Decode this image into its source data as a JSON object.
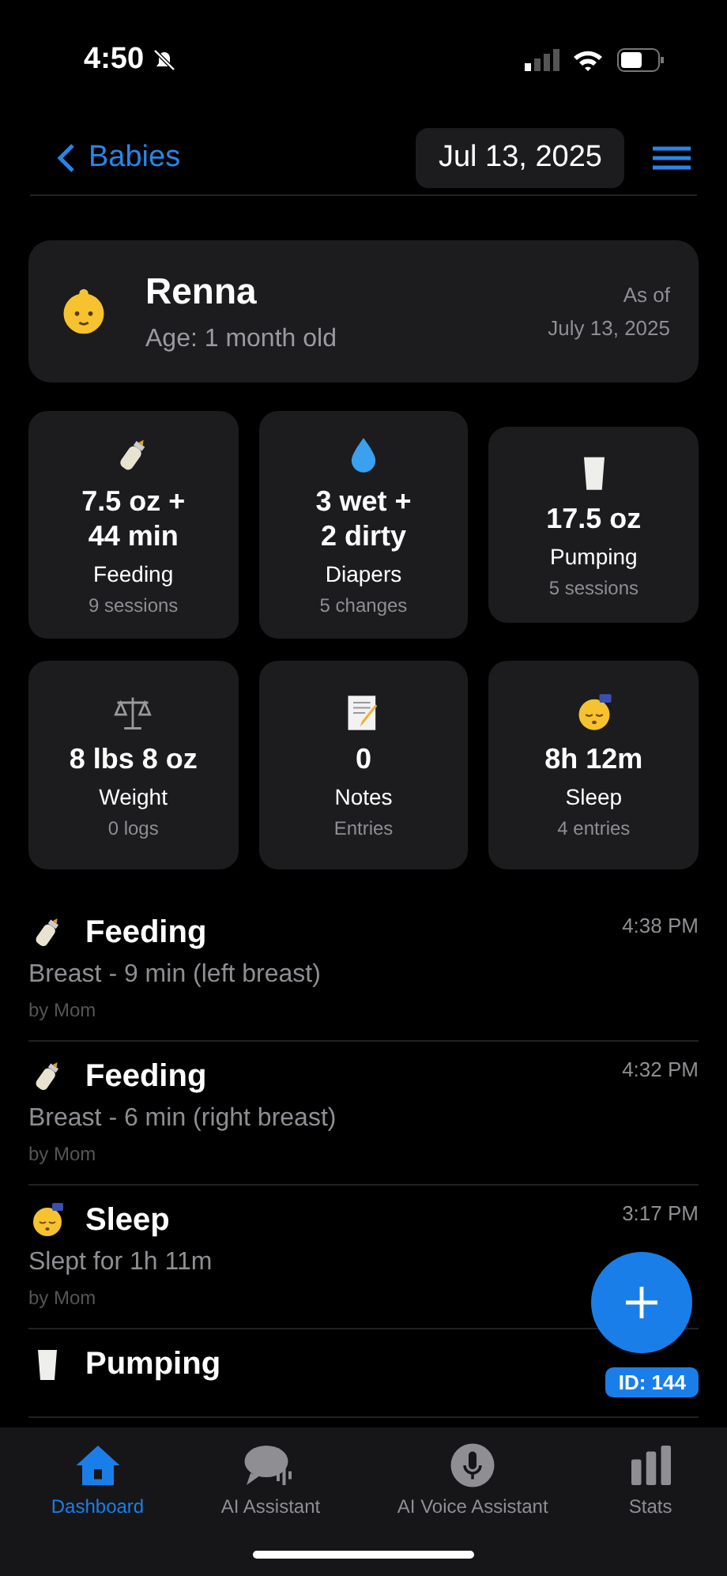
{
  "status_bar": {
    "time": "4:50"
  },
  "nav": {
    "back": "Babies",
    "date": "Jul 13, 2025"
  },
  "profile": {
    "name": "Renna",
    "age": "Age: 1 month old",
    "as_of": "As of",
    "as_of_date": "July 13, 2025"
  },
  "stats": [
    {
      "kind": "bottle",
      "value": "7.5 oz +\n44 min",
      "label": "Feeding",
      "sub": "9 sessions"
    },
    {
      "kind": "drop",
      "value": "3 wet +\n2 dirty",
      "label": "Diapers",
      "sub": "5 changes"
    },
    {
      "kind": "milk",
      "value": "17.5 oz",
      "label": "Pumping",
      "sub": "5 sessions"
    },
    {
      "kind": "scale",
      "value": "8 lbs 8 oz",
      "label": "Weight",
      "sub": "0 logs"
    },
    {
      "kind": "memo",
      "value": "0",
      "label": "Notes",
      "sub": "Entries"
    },
    {
      "kind": "sleep",
      "value": "8h 12m",
      "label": "Sleep",
      "sub": "4 entries"
    }
  ],
  "entries": [
    {
      "kind": "bottle",
      "title": "Feeding",
      "detail": "Breast - 9 min (left breast)",
      "by": "by Mom",
      "time": "4:38 PM"
    },
    {
      "kind": "bottle",
      "title": "Feeding",
      "detail": "Breast - 6 min (right breast)",
      "by": "by Mom",
      "time": "4:32 PM"
    },
    {
      "kind": "sleep",
      "title": "Sleep",
      "detail": "Slept for 1h 11m",
      "by": "by Mom",
      "time": "3:17 PM"
    },
    {
      "kind": "milk",
      "title": "Pumping",
      "badge": "ID: 144"
    }
  ],
  "tabs": [
    {
      "kind": "home",
      "label": "Dashboard",
      "selected": true
    },
    {
      "kind": "chat",
      "label": "AI Assistant",
      "selected": false
    },
    {
      "kind": "mic",
      "label": "AI Voice Assistant",
      "selected": false
    },
    {
      "kind": "bars",
      "label": "Stats",
      "selected": false
    }
  ]
}
